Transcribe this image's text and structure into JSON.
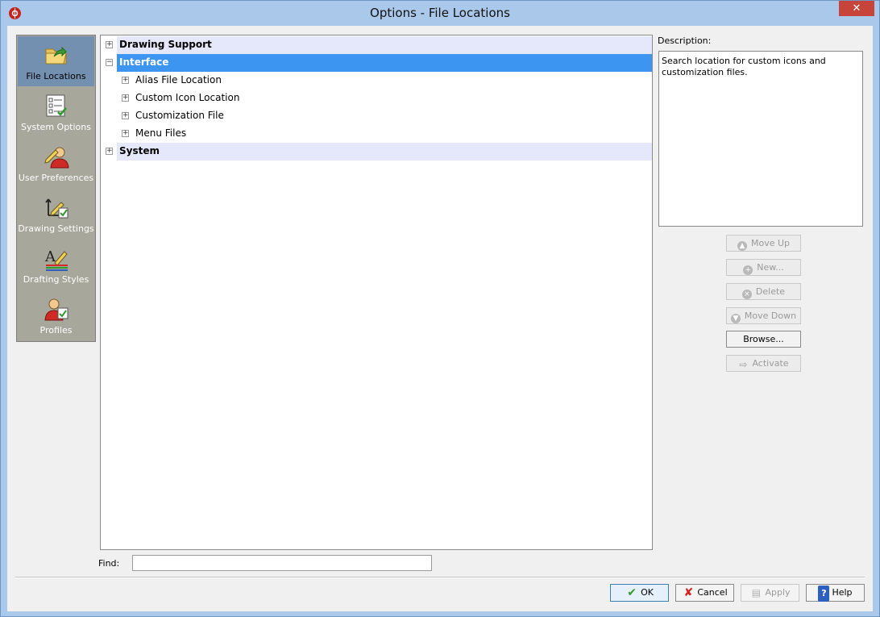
{
  "window": {
    "title": "Options - File Locations",
    "close_glyph": "✕"
  },
  "nav": {
    "items": [
      {
        "label": "File Locations",
        "icon": "folder-arrow-icon",
        "selected": true
      },
      {
        "label": "System Options",
        "icon": "checklist-icon"
      },
      {
        "label": "User Preferences",
        "icon": "user-pencil-icon"
      },
      {
        "label": "Drawing Settings",
        "icon": "drawing-settings-icon"
      },
      {
        "label": "Drafting Styles",
        "icon": "drafting-styles-icon"
      },
      {
        "label": "Profiles",
        "icon": "profile-user-icon"
      }
    ]
  },
  "tree": {
    "groups": [
      {
        "label": "Drawing Support",
        "expanded": false
      },
      {
        "label": "Interface",
        "expanded": true,
        "selected": true,
        "children": [
          "Alias File Location",
          "Custom Icon Location",
          "Customization File",
          "Menu Files"
        ]
      },
      {
        "label": "System",
        "expanded": false
      }
    ],
    "collapsed_glyph": "+",
    "expanded_glyph": "−"
  },
  "description": {
    "label": "Description:",
    "text": "Search location for custom icons and customization files."
  },
  "side_buttons": {
    "move_up": "Move Up",
    "new": "New...",
    "delete": "Delete",
    "move_down": "Move Down",
    "browse": "Browse...",
    "activate": "Activate"
  },
  "find": {
    "label": "Find:",
    "value": ""
  },
  "footer": {
    "ok": "OK",
    "cancel": "Cancel",
    "apply": "Apply",
    "help": "Help"
  },
  "colors": {
    "selection": "#3d95f2",
    "group_row": "#e5e8fa",
    "nav_bg": "#a7a79b",
    "nav_selected": "#7390b0"
  }
}
